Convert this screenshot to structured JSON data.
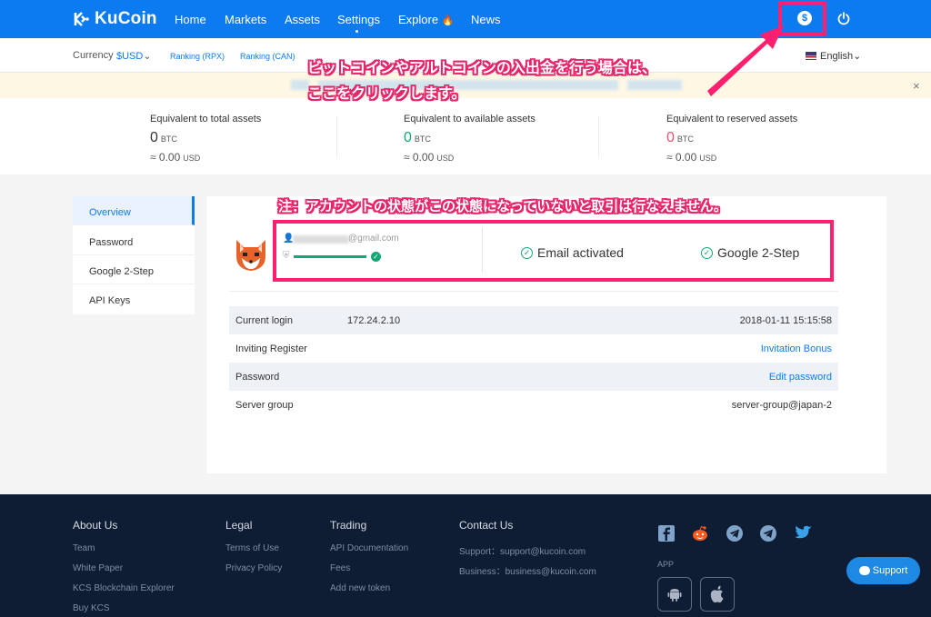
{
  "nav": {
    "logo_text": "KuCoin",
    "items": [
      "Home",
      "Markets",
      "Assets",
      "Settings",
      "Explore",
      "News"
    ],
    "active": "Settings",
    "explore_badge_icon": "flame-icon",
    "deposit_icon": "dollar-coin-icon",
    "logout_icon": "power-icon"
  },
  "subbar": {
    "currency_label": "Currency",
    "currency_value": "$USD",
    "ranking_links": [
      "Ranking (RPX)",
      "Ranking (CAN)"
    ],
    "language": "English"
  },
  "notice": {
    "close": "×"
  },
  "balances": [
    {
      "label": "Equivalent to total assets",
      "value": "0",
      "unit": "BTC",
      "usd": "≈ 0.00",
      "usd_unit": "USD",
      "color": "#333333"
    },
    {
      "label": "Equivalent to available assets",
      "value": "0",
      "unit": "BTC",
      "usd": "≈ 0.00",
      "usd_unit": "USD",
      "color": "#12a876"
    },
    {
      "label": "Equivalent to reserved assets",
      "value": "0",
      "unit": "BTC",
      "usd": "≈ 0.00",
      "usd_unit": "USD",
      "color": "#f0506e"
    }
  ],
  "annotations": {
    "deposit_line1": "ビットコインやアルトコインの入出金を行う場合は、",
    "deposit_line2": "ここをクリックします。",
    "account_note": "注：アカウントの状態がこの状態になっていないと取引は行なえません。",
    "highlight_color": "#ff1f6f"
  },
  "sidemenu": {
    "items": [
      "Overview",
      "Password",
      "Google 2-Step",
      "API Keys"
    ],
    "active": "Overview"
  },
  "account": {
    "email_suffix": "@gmail.com",
    "security_progress": 1.0,
    "statuses": [
      "Email activated",
      "Google 2-Step"
    ]
  },
  "info_rows": [
    {
      "label": "Current login",
      "mid": "172.24.2.10",
      "right": "2018-01-11 15:15:58",
      "link": false
    },
    {
      "label": "Inviting Register",
      "mid": "",
      "right": "Invitation Bonus",
      "link": true
    },
    {
      "label": "Password",
      "mid": "",
      "right": "Edit password",
      "link": true
    },
    {
      "label": "Server group",
      "mid": "",
      "right": "server-group@japan-2",
      "link": false
    }
  ],
  "footer": {
    "columns": [
      {
        "title": "About Us",
        "links": [
          "Team",
          "White Paper",
          "KCS Blockchain Explorer",
          "Buy KCS"
        ]
      },
      {
        "title": "Legal",
        "links": [
          "Terms of Use",
          "Privacy Policy"
        ]
      },
      {
        "title": "Trading",
        "links": [
          "API Documentation",
          "Fees",
          "Add new token"
        ]
      },
      {
        "title": "Contact Us",
        "links": [
          "Support：support@kucoin.com",
          "Business：business@kucoin.com"
        ]
      }
    ],
    "social_icons": [
      "facebook-icon",
      "reddit-icon",
      "telegram-icon",
      "telegram-icon",
      "twitter-icon"
    ],
    "app_label": "APP",
    "app_icons": [
      "android-icon",
      "apple-icon"
    ],
    "support_label": "Support"
  }
}
